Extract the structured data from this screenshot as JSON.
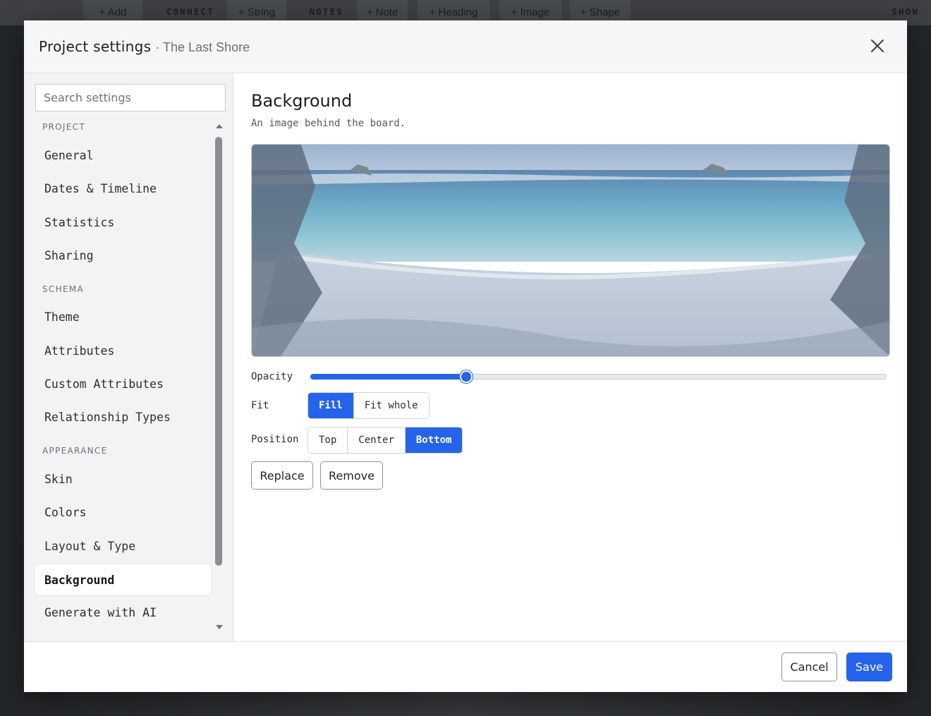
{
  "toolbar": {
    "add": "+ Add",
    "connect": "CONNECT",
    "string": "+ String",
    "notes": "NOTES",
    "note": "+ Note",
    "heading": "+ Heading",
    "image": "+ Image",
    "shape": "+ Shape",
    "show": "SHOW"
  },
  "modal": {
    "title": "Project settings",
    "subtitle": "· The Last Shore"
  },
  "sidebar": {
    "search_placeholder": "Search settings",
    "sections": [
      {
        "label": "PROJECT",
        "items": [
          {
            "label": "General"
          },
          {
            "label": "Dates & Timeline"
          },
          {
            "label": "Statistics"
          },
          {
            "label": "Sharing"
          }
        ]
      },
      {
        "label": "SCHEMA",
        "items": [
          {
            "label": "Theme"
          },
          {
            "label": "Attributes"
          },
          {
            "label": "Custom Attributes"
          },
          {
            "label": "Relationship Types"
          }
        ]
      },
      {
        "label": "APPEARANCE",
        "items": [
          {
            "label": "Skin"
          },
          {
            "label": "Colors"
          },
          {
            "label": "Layout & Type"
          },
          {
            "label": "Background",
            "active": true
          },
          {
            "label": "Generate with AI"
          }
        ]
      }
    ]
  },
  "main": {
    "title": "Background",
    "description": "An image behind the board.",
    "opacity_label": "Opacity",
    "opacity_value": 0.27,
    "fit_label": "Fit",
    "fit_options": [
      "Fill",
      "Fit whole"
    ],
    "fit_selected": "Fill",
    "position_label": "Position",
    "position_options": [
      "Top",
      "Center",
      "Bottom"
    ],
    "position_selected": "Bottom",
    "replace_label": "Replace",
    "remove_label": "Remove"
  },
  "footer": {
    "cancel_label": "Cancel",
    "save_label": "Save"
  },
  "colors": {
    "accent": "#2563eb"
  }
}
